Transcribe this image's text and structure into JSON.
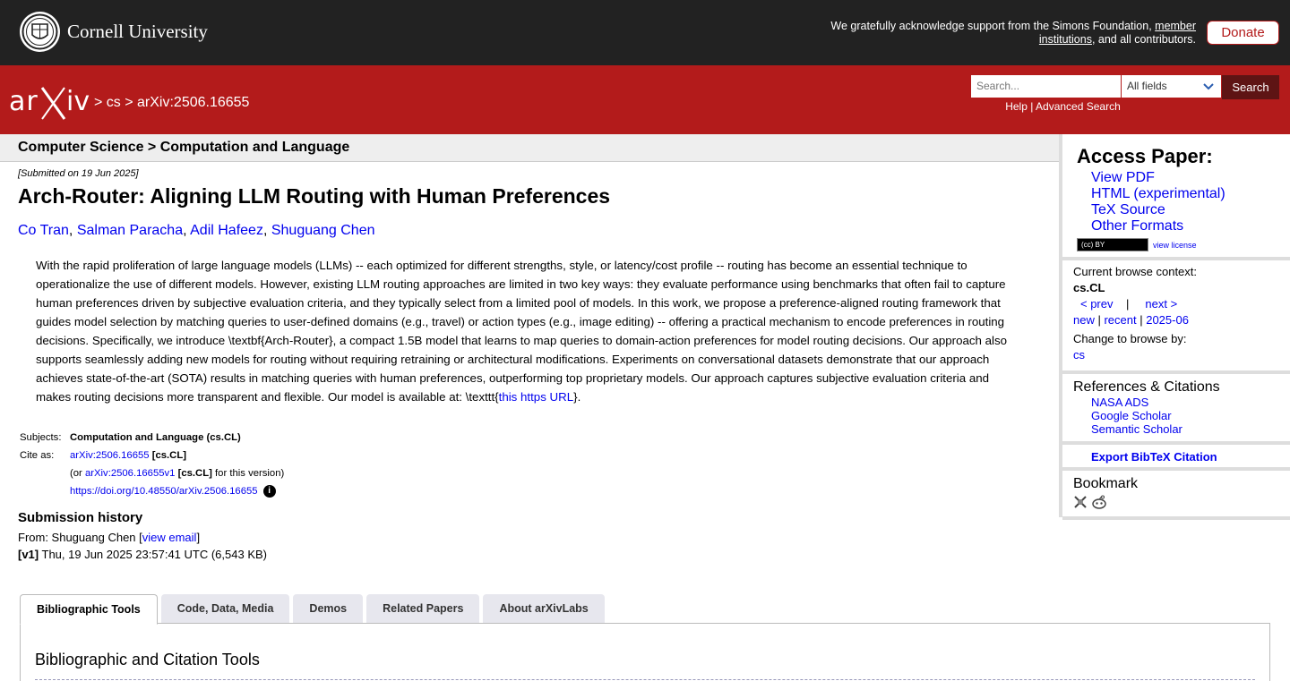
{
  "header": {
    "university": "Cornell University",
    "ack_text": "We gratefully acknowledge support from the Simons Foundation, ",
    "ack_link": "member institutions",
    "ack_tail": ", and all contributors.",
    "donate_label": "Donate"
  },
  "arxiv_bar": {
    "logo": "arXiv",
    "breadcrumb": "> cs > arXiv:2506.16655",
    "search_placeholder": "Search...",
    "search_field": "All fields",
    "search_label": "Search",
    "help": "Help",
    "sep": " | ",
    "advanced": "Advanced Search"
  },
  "subheader": "Computer Science > Computation and Language",
  "paper": {
    "submitted": "[Submitted on 19 Jun 2025]",
    "title": "Arch-Router: Aligning LLM Routing with Human Preferences",
    "authors": [
      "Co Tran",
      "Salman Paracha",
      "Adil Hafeez",
      "Shuguang Chen"
    ],
    "abstract": "With the rapid proliferation of large language models (LLMs) -- each optimized for different strengths, style, or latency/cost profile -- routing has become an essential technique to operationalize the use of different models. However, existing LLM routing approaches are limited in two key ways: they evaluate performance using benchmarks that often fail to capture human preferences driven by subjective evaluation criteria, and they typically select from a limited pool of models. In this work, we propose a preference-aligned routing framework that guides model selection by matching queries to user-defined domains (e.g., travel) or action types (e.g., image editing) -- offering a practical mechanism to encode preferences in routing decisions. Specifically, we introduce \\textbf{Arch-Router}, a compact 1.5B model that learns to map queries to domain-action preferences for model routing decisions. Our approach also supports seamlessly adding new models for routing without requiring retraining or architectural modifications. Experiments on conversational datasets demonstrate that our approach achieves state-of-the-art (SOTA) results in matching queries with human preferences, outperforming top proprietary models. Our approach captures subjective evaluation criteria and makes routing decisions more transparent and flexible. Our model is available at: \\texttt{",
    "abstract_link": "this https URL",
    "abstract_end": "}."
  },
  "meta": {
    "subjects_label": "Subjects:",
    "subjects": "Computation and Language (cs.CL)",
    "cite_label": "Cite as:",
    "cite_id": "arXiv:2506.16655",
    "cite_cat": " [cs.CL]",
    "or_prefix": "(or ",
    "cite_v1": "arXiv:2506.16655v1",
    "or_cat": " [cs.CL]",
    "or_suffix": " for this version)",
    "doi": "https://doi.org/10.48550/arXiv.2506.16655"
  },
  "history": {
    "title": "Submission history",
    "from": "From: Shuguang Chen [",
    "email_link": "view email",
    "from_end": "]",
    "v1_label": "[v1]",
    "v1_text": " Thu, 19 Jun 2025 23:57:41 UTC (6,543 KB)"
  },
  "tabs": [
    "Bibliographic Tools",
    "Code, Data, Media",
    "Demos",
    "Related Papers",
    "About arXivLabs"
  ],
  "panel_title": "Bibliographic and Citation Tools",
  "sidebar": {
    "access_title": "Access Paper:",
    "formats": [
      "View PDF",
      "HTML (experimental)",
      "TeX Source",
      "Other Formats"
    ],
    "cc": "(cc) BY",
    "view_license": "view license",
    "context_label": "Current browse context:",
    "context": "cs.CL",
    "prev": "< prev",
    "next": "next >",
    "new": "new",
    "recent": "recent",
    "date": "2025-06",
    "change_label": "Change to browse by:",
    "cs": "cs",
    "refs_title": "References & Citations",
    "refs": [
      "NASA ADS",
      "Google Scholar",
      "Semantic Scholar"
    ],
    "bibtex": "Export BibTeX Citation",
    "bookmark": "Bookmark"
  }
}
